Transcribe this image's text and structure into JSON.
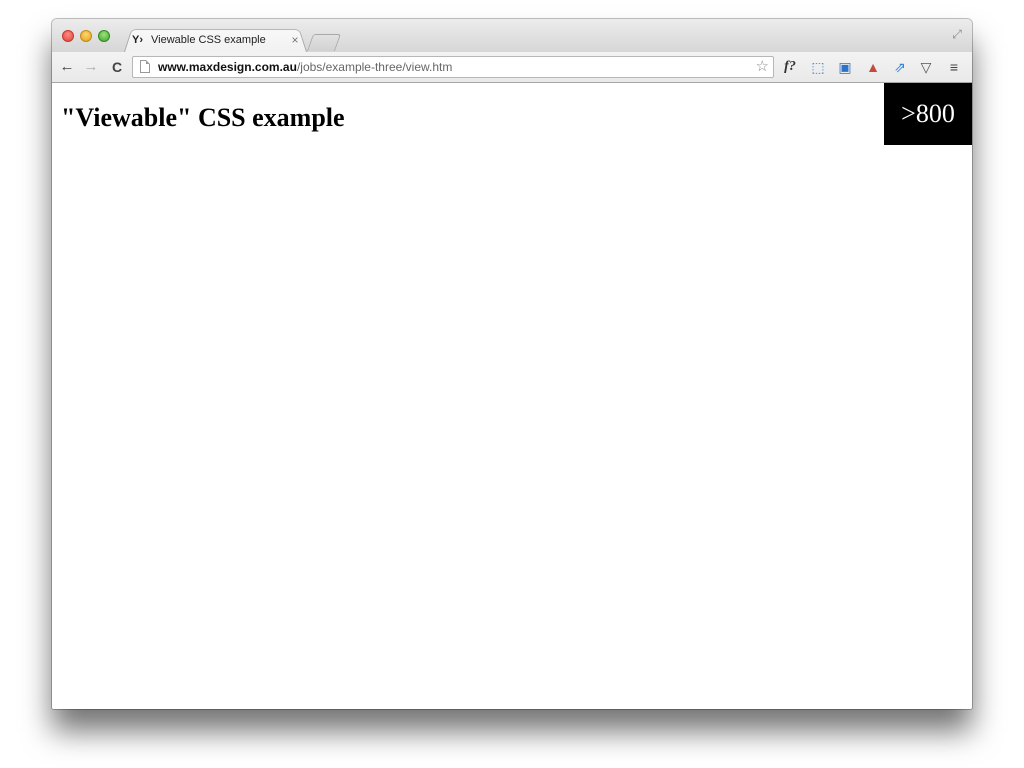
{
  "browser": {
    "tab": {
      "title": "Viewable CSS example",
      "favicon": "maxdesign-favicon",
      "close_label": "×"
    },
    "address_bar": {
      "host": "www.maxdesign.com.au",
      "path": "/jobs/example-three/view.htm"
    },
    "icons": {
      "back": "←",
      "forward": "→",
      "reload": "C",
      "bookmark": "☆",
      "fquestion": "f?",
      "screen": "⬚",
      "image": "▣",
      "car": "▲",
      "share": "⇗",
      "pocket": "▽",
      "menu": "≡",
      "fullscreen": "⤢"
    }
  },
  "page": {
    "heading": "\"Viewable\" CSS example",
    "width_badge": ">800"
  },
  "colors": {
    "badge_background": "#000000",
    "badge_text": "#ffffff",
    "page_background": "#ffffff"
  }
}
